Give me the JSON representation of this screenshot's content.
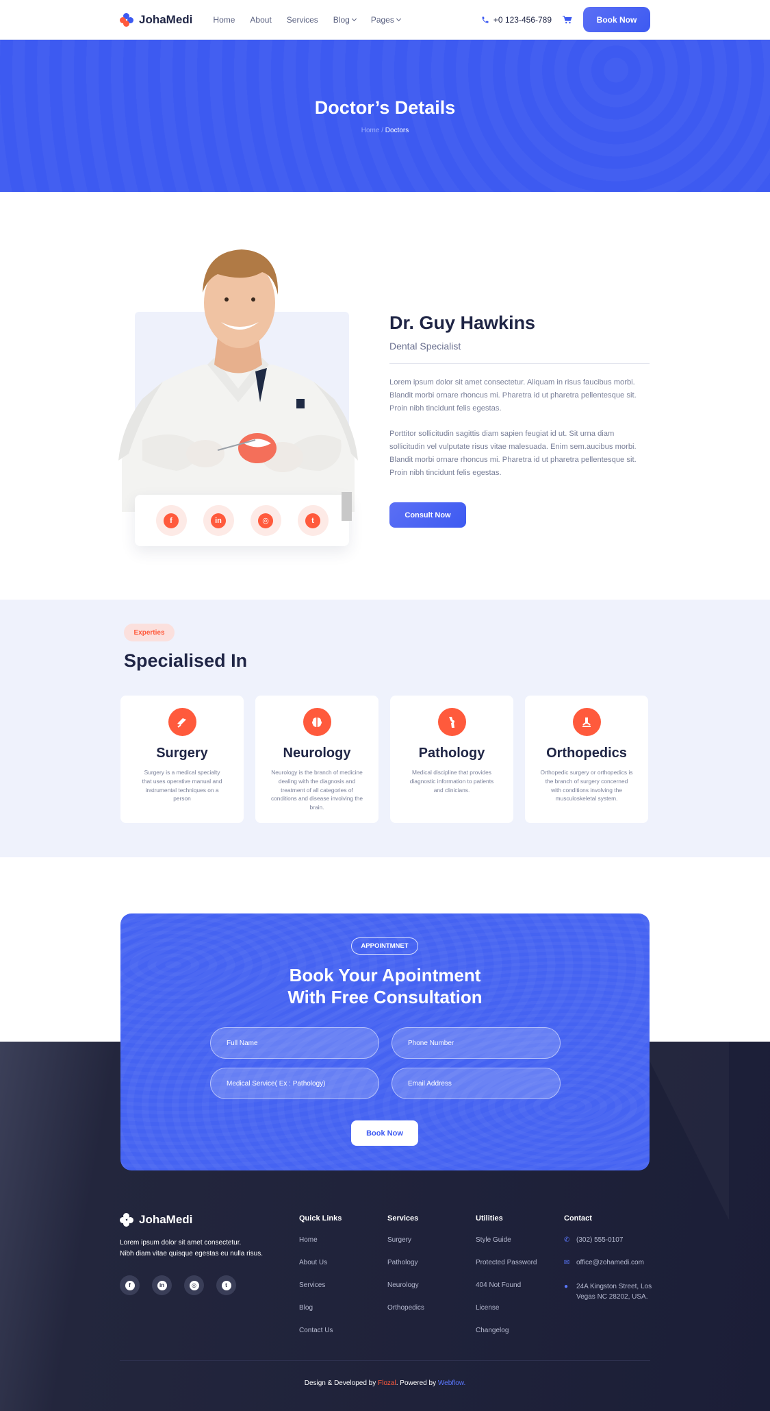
{
  "nav": {
    "brand": "JohaMedi",
    "links": [
      "Home",
      "About",
      "Services",
      "Blog",
      "Pages"
    ],
    "phone": "+0 123-456-789",
    "book_label": "Book Now"
  },
  "hero": {
    "title": "Doctor’s Details",
    "crumb_home": "Home",
    "crumb_sep": " / ",
    "crumb_current": "Doctors"
  },
  "doctor": {
    "name": "Dr. Guy Hawkins",
    "role": "Dental Specialist",
    "para1": "Lorem ipsum dolor sit amet consectetur. Aliquam in risus faucibus morbi. Blandit morbi ornare rhoncus mi. Pharetra id ut pharetra pellentesque sit. Proin nibh tincidunt felis egestas.",
    "para2": "Porttitor sollicitudin sagittis diam sapien feugiat id ut. Sit urna diam sollicitudin vel vulputate risus vitae malesuada. Enim sem.aucibus morbi. Blandit morbi ornare rhoncus mi. Pharetra id ut pharetra pellentesque sit. Proin nibh tincidunt felis egestas.",
    "consult_label": "Consult Now",
    "social_icons": [
      "facebook-icon",
      "linkedin-icon",
      "instagram-icon",
      "twitter-icon"
    ]
  },
  "specialised": {
    "pill": "Experties",
    "title": "Specialised In",
    "cards": [
      {
        "title": "Surgery",
        "text": "Surgery is a medical specialty that uses operative manual and instrumental techniques on a person"
      },
      {
        "title": "Neurology",
        "text": "Neurology is the branch of medicine dealing with the diagnosis and treatment of all categories of conditions and disease involving the brain."
      },
      {
        "title": "Pathology",
        "text": "Medical discipline that provides diagnostic information to patients and clinicians."
      },
      {
        "title": "Orthopedics",
        "text": "Orthopedic surgery or orthopedics is the branch of surgery concerned with conditions involving the musculoskeletal system."
      }
    ]
  },
  "appointment": {
    "pill": "APPOINTMNET",
    "title_line1": "Book Your Apointment",
    "title_line2": "With Free Consultation",
    "full_name": "Full Name",
    "phone": "Phone Number",
    "service": "Medical Service( Ex : Pathology)",
    "email": "Email Address",
    "button": "Book Now"
  },
  "footer": {
    "brand": "JohaMedi",
    "about_line1": "Lorem ipsum dolor sit amet consectetur.",
    "about_line2": "Nibh diam vitae quisque egestas eu nulla risus.",
    "quick_title": "Quick Links",
    "quick": [
      "Home",
      "About Us",
      "Services",
      "Blog",
      "Contact Us"
    ],
    "services_title": "Services",
    "services": [
      "Surgery",
      "Pathology",
      "Neurology",
      "Orthopedics"
    ],
    "utilities_title": "Utilities",
    "utilities": [
      "Style Guide",
      "Protected Password",
      "404 Not Found",
      "License",
      "Changelog"
    ],
    "contact_title": "Contact",
    "contact_phone": "(302) 555-0107",
    "contact_email": "office@zohamedi.com",
    "contact_addr1": "24A Kingston Street, Los",
    "contact_addr2": "Vegas NC 28202, USA.",
    "copy_pre": "Design & Developed by ",
    "copy_by": "Flozal",
    "copy_mid": ". Powered by ",
    "copy_platform": "Webflow."
  },
  "colors": {
    "primary": "#3d5af1",
    "accent": "#ff5a3c",
    "dark": "#1b1e37"
  }
}
